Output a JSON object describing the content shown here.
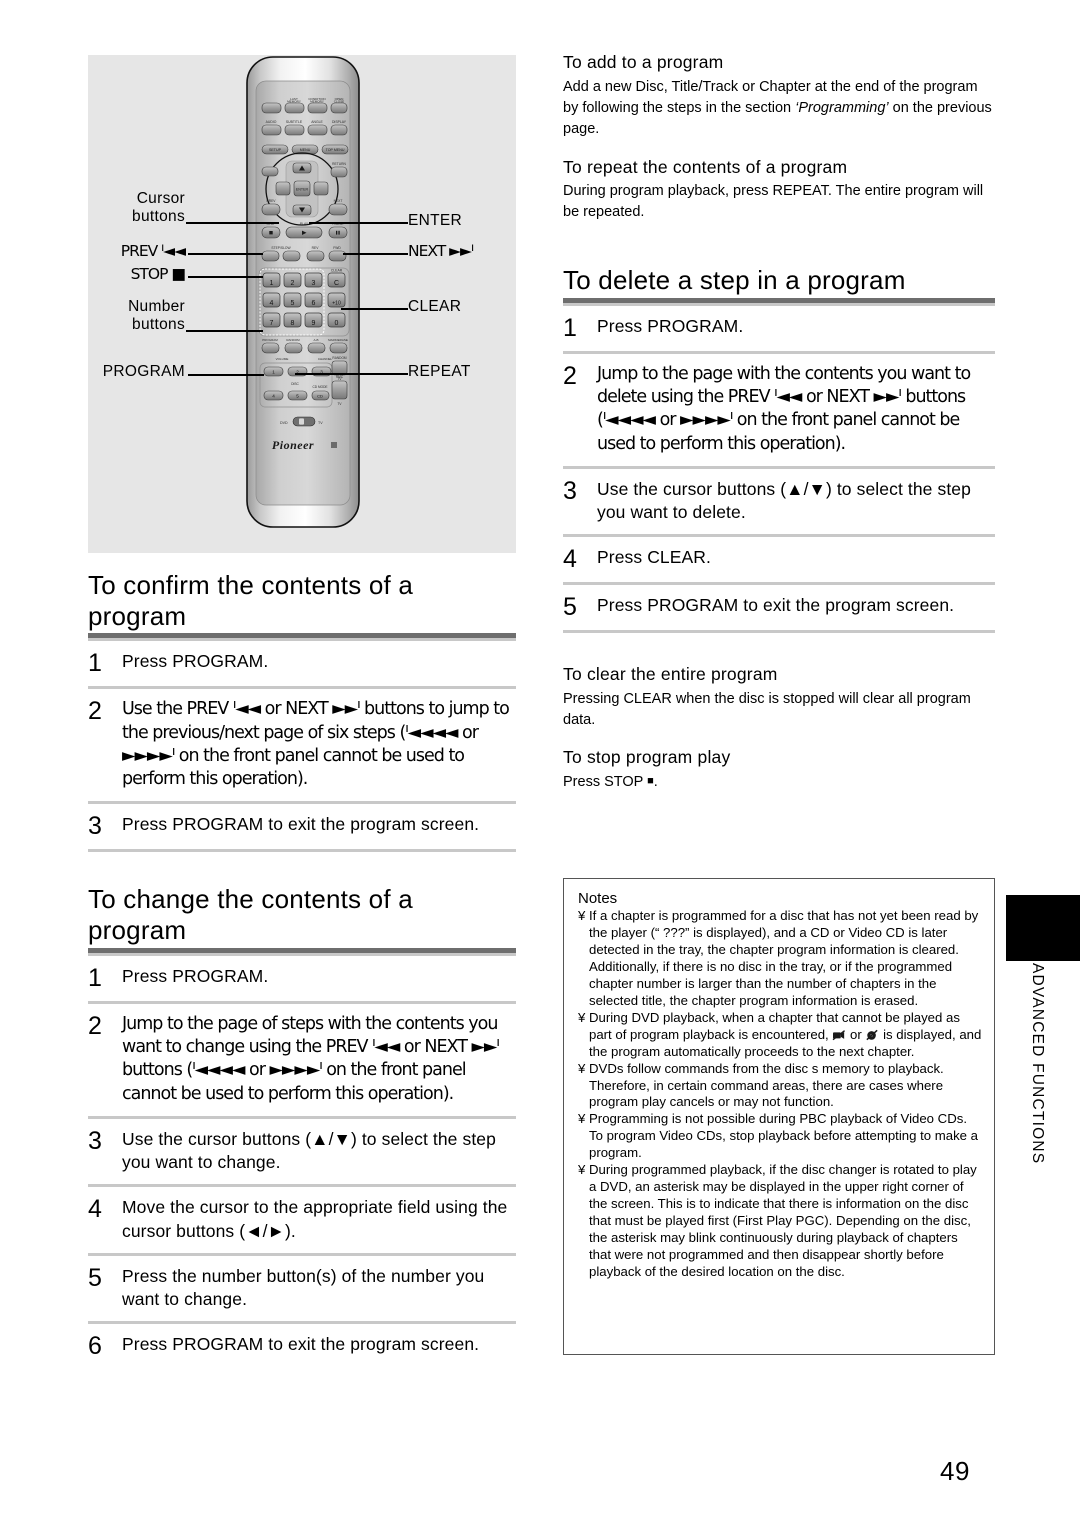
{
  "page": {
    "number": "49",
    "side_tab": "ADVANCED FUNCTIONS"
  },
  "figure": {
    "brand": "Pioneer",
    "callouts_left": [
      {
        "name": "cursor-buttons",
        "line1": "Cursor",
        "line2": "buttons"
      },
      {
        "name": "prev",
        "line1": "PREV ᑊ◄◄",
        "line2": ""
      },
      {
        "name": "stop",
        "line1": "STOP ■",
        "line2": ""
      },
      {
        "name": "number-buttons",
        "line1": "Number",
        "line2": "buttons"
      },
      {
        "name": "program",
        "line1": "PROGRAM",
        "line2": ""
      }
    ],
    "callouts_right": [
      {
        "name": "enter",
        "label": "ENTER"
      },
      {
        "name": "next",
        "label": "NEXT ►►ᑊ"
      },
      {
        "name": "clear",
        "label": "CLEAR"
      },
      {
        "name": "repeat",
        "label": "REPEAT"
      }
    ],
    "keypad": [
      "1",
      "2",
      "3",
      "C",
      "4",
      "5",
      "6",
      "+10",
      "7",
      "8",
      "9",
      "0"
    ],
    "top_labels": [
      "LAST MEMORY",
      "CONDITION MEMORY",
      "OPEN/CLOSE",
      "AUDIO",
      "SUBTITLE",
      "ANGLE",
      "DISPLAY",
      "SETUP",
      "MENU",
      "TOP MENU",
      "RETURN",
      "PREV",
      "NEXT",
      "STOP",
      "PLAY",
      "PAUSE",
      "STEP/SLOW",
      "REV",
      "FWD",
      "CLEAR",
      "PROGRAM",
      "RANDOM",
      "A-B",
      "MARK/ERASE",
      "VOLUME",
      "CHANNEL",
      "DISC",
      "CD MODE",
      "RANDOM",
      "TV",
      "DVD",
      "TV"
    ]
  },
  "left_column": {
    "section_confirm": {
      "heading": "To confirm the contents of a program",
      "steps": [
        {
          "num": "1",
          "text": "Press PROGRAM."
        },
        {
          "num": "2",
          "text": "Use the PREV ᑊ◄◄ or NEXT ►►ᑊ buttons to jump to the previous/next page of six steps (ᑊ◄◄◄◄ or ►►►►ᑊ on the front panel cannot be used to perform this operation)."
        },
        {
          "num": "3",
          "text": "Press PROGRAM to exit the program screen."
        }
      ]
    },
    "section_change": {
      "heading": "To change the contents of a program",
      "steps": [
        {
          "num": "1",
          "text": "Press PROGRAM."
        },
        {
          "num": "2",
          "text": "Jump to the page of steps with the contents you want to change using the PREV ᑊ◄◄ or NEXT ►►ᑊ buttons (ᑊ◄◄◄◄ or ►►►►ᑊ on the front panel cannot be used to perform this operation)."
        },
        {
          "num": "3",
          "text": "Use the cursor buttons (▲/▼) to select the step you want to change."
        },
        {
          "num": "4",
          "text": "Move the cursor to the appropriate field using the cursor buttons (◄/►)."
        },
        {
          "num": "5",
          "text": "Press the number button(s) of the number you want to change."
        },
        {
          "num": "6",
          "text": "Press PROGRAM to exit the program screen."
        }
      ]
    }
  },
  "right_column": {
    "sub_add": {
      "heading": "To add to a program",
      "body_1": "Add a new Disc, Title/Track or Chapter at the end of the program by following the steps in the section ",
      "body_italic": "‘Programming’",
      "body_2": " on the previous page."
    },
    "sub_repeat": {
      "heading": "To repeat the contents of a program",
      "body": "During program playback, press REPEAT. The entire program will be repeated."
    },
    "section_delete": {
      "heading": "To delete a step in a program",
      "steps": [
        {
          "num": "1",
          "text": "Press PROGRAM."
        },
        {
          "num": "2",
          "text": "Jump to the page with the contents you want to delete using the PREV ᑊ◄◄ or NEXT ►►ᑊ buttons (ᑊ◄◄◄◄ or ►►►►ᑊ on the front panel cannot be used to perform this operation)."
        },
        {
          "num": "3",
          "text": "Use the cursor buttons (▲/▼) to select the step you want to delete."
        },
        {
          "num": "4",
          "text": "Press CLEAR."
        },
        {
          "num": "5",
          "text": "Press PROGRAM to exit the program screen."
        }
      ]
    },
    "sub_clear": {
      "heading": "To clear the entire program",
      "body": "Pressing CLEAR when the disc is stopped will clear all program data."
    },
    "sub_stop": {
      "heading": "To stop program play",
      "body_prefix": "Press STOP ",
      "body_suffix": "."
    }
  },
  "notes": {
    "title": "Notes",
    "bullet": "¥",
    "items": [
      {
        "text": "If a chapter is programmed for a disc that has not yet been read by the player (“ ???”  is displayed), and a CD or Video CD is later detected in the tray, the chapter program information is cleared. Additionally, if there is no disc in the tray, or if the programmed chapter number is larger than the number of chapters in the selected title, the chapter program information is erased."
      },
      {
        "text_1": "During DVD playback, when a chapter that cannot be played as part of program playback is encountered, ",
        "icon_1": "no-camera-icon",
        "text_2": " or ",
        "icon_2": "no-disc-icon",
        "text_3": " is displayed, and the program automatically proceeds to the next chapter."
      },
      {
        "text": "DVDs follow commands from the disc s memory to playback. Therefore, in certain command areas, there are cases where program play cancels or may not function."
      },
      {
        "text": "Programming is not possible during PBC playback of Video CDs. To program Video CDs, stop playback before attempting to make a program."
      },
      {
        "text": "During programmed playback, if the disc changer is rotated to play a DVD, an asterisk may be displayed in the upper right corner of the screen. This is to indicate that there is information on the disc that must be played first (First Play PGC). Depending on the disc, the asterisk may blink continuously during playback of chapters that were not programmed and then disappear shortly before playback of the desired location on the disc."
      }
    ]
  },
  "colors": {
    "heading_rule": "#6e6e6e",
    "step_rule": "#c8c8c8",
    "figure_bg": "#e6e6e6",
    "notes_border": "#555555",
    "tab_black": "#000000"
  }
}
